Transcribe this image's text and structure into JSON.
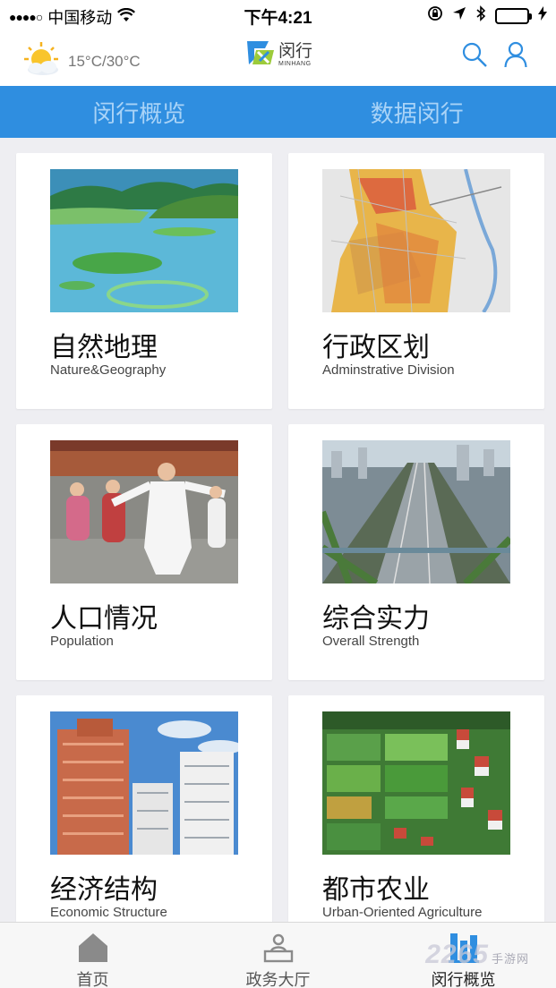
{
  "status_bar": {
    "signal": "●●●●○",
    "carrier": "中国移动",
    "time": "下午4:21"
  },
  "header": {
    "weather_text": "15°C/30°C",
    "logo_cn": "闵行",
    "logo_en": "MINHANG"
  },
  "tabs": [
    {
      "label": "闵行概览"
    },
    {
      "label": "数据闵行"
    }
  ],
  "cards": [
    {
      "cn": "自然地理",
      "en": "Nature&Geography"
    },
    {
      "cn": "行政区划",
      "en": "Adminstrative Division"
    },
    {
      "cn": "人口情况",
      "en": "Population"
    },
    {
      "cn": "综合实力",
      "en": "Overall Strength"
    },
    {
      "cn": "经济结构",
      "en": "Economic Structure"
    },
    {
      "cn": "都市农业",
      "en": "Urban-Oriented Agriculture"
    }
  ],
  "bottom_nav": [
    {
      "label": "首页",
      "icon": "home-icon"
    },
    {
      "label": "政务大厅",
      "icon": "hall-icon"
    },
    {
      "label": "闵行概览",
      "icon": "overview-icon"
    }
  ],
  "watermark": {
    "text": "2265",
    "suffix": "手游网"
  },
  "colors": {
    "accent": "#2f8ee0",
    "tab_text": "#a9d3f7",
    "background": "#eeeef2",
    "battery": "#4cd964"
  }
}
